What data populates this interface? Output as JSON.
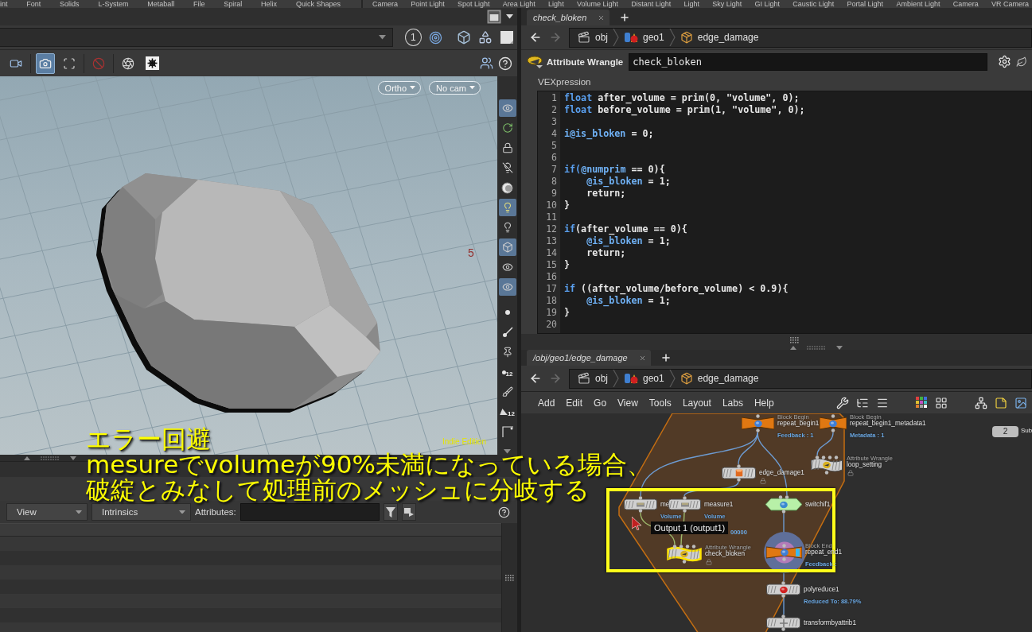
{
  "shelf": {
    "create_tools": [
      "int",
      "Font",
      "Solids",
      "L-System",
      "Metaball",
      "File",
      "Spiral",
      "Helix",
      "Quick Shapes"
    ],
    "light_tools": [
      "Camera",
      "Point Light",
      "Spot Light",
      "Area Light",
      "Light",
      "Volume Light",
      "Distant Light",
      "Light",
      "Sky Light",
      "GI Light",
      "Caustic Light",
      "Portal Light",
      "Ambient Light",
      "Camera",
      "VR Camera"
    ]
  },
  "viewer": {
    "layout_count": "1",
    "tools": [
      {
        "selected": false
      },
      {
        "selected": true
      },
      {
        "selected": false
      },
      {
        "selected": false
      },
      {
        "selected": false
      },
      {
        "selected": false
      }
    ],
    "camera_buttons": [
      {
        "label": "Ortho"
      },
      {
        "label": "No cam"
      }
    ],
    "grid_number": "5",
    "edition": "Indie Edition",
    "side_tools": [
      {
        "selected": true
      },
      {
        "selected": false
      },
      {
        "selected": false
      },
      {
        "selected": false
      },
      {
        "selected": false
      },
      {
        "selected": true
      },
      {
        "selected": false
      },
      {
        "selected": true
      },
      {
        "selected": false
      },
      {
        "selected": true
      },
      {
        "selected": false
      },
      {
        "selected": false
      },
      {
        "selected": false
      },
      {
        "selected": false,
        "label": "12"
      },
      {
        "selected": false
      },
      {
        "selected": false,
        "label": "12"
      },
      {
        "selected": false
      },
      {
        "selected": false
      }
    ]
  },
  "spreadsheet": {
    "view_menu": "View",
    "info_menu": "Intrinsics",
    "attributes_label": "Attributes:"
  },
  "parameters": {
    "tabs": [
      {
        "label": "check_bloken",
        "selected": true
      }
    ],
    "path": [
      {
        "label": "obj"
      },
      {
        "label": "geo1"
      },
      {
        "label": "edge_damage"
      }
    ],
    "node_type": "Attribute Wrangle",
    "node_name": "check_bloken",
    "code_label": "VEXpression",
    "code_lines": [
      {
        "number": "1",
        "tokens": [
          {
            "text": "float",
            "kind": "keyword"
          },
          {
            "text": " after_volume = prim(0, \"volume\", 0);",
            "kind": "plain"
          }
        ]
      },
      {
        "number": "2",
        "tokens": [
          {
            "text": "float",
            "kind": "keyword"
          },
          {
            "text": " before_volume = prim(1, \"volume\", 0);",
            "kind": "plain"
          }
        ]
      },
      {
        "number": "3"
      },
      {
        "number": "4",
        "tokens": [
          {
            "text": "i@is_bloken",
            "kind": "attr"
          },
          {
            "text": " = 0;",
            "kind": "plain"
          }
        ]
      },
      {
        "number": "5"
      },
      {
        "number": "6"
      },
      {
        "number": "7",
        "tokens": [
          {
            "text": "if(",
            "kind": "keyword"
          },
          {
            "text": "@numprim",
            "kind": "attr"
          },
          {
            "text": " == 0){",
            "kind": "plain"
          }
        ]
      },
      {
        "number": "8",
        "tokens": [
          {
            "text": "    @is_bloken",
            "kind": "attr"
          },
          {
            "text": " = 1;",
            "kind": "plain"
          }
        ]
      },
      {
        "number": "9",
        "tokens": [
          {
            "text": "    return;",
            "kind": "plain"
          }
        ]
      },
      {
        "number": "10",
        "tokens": [
          {
            "text": "}",
            "kind": "plain"
          }
        ]
      },
      {
        "number": "11"
      },
      {
        "number": "12",
        "tokens": [
          {
            "text": "if",
            "kind": "keyword"
          },
          {
            "text": "(after_volume == 0){",
            "kind": "plain"
          }
        ]
      },
      {
        "number": "13",
        "tokens": [
          {
            "text": "    @is_bloken",
            "kind": "attr"
          },
          {
            "text": " = 1;",
            "kind": "plain"
          }
        ]
      },
      {
        "number": "14",
        "tokens": [
          {
            "text": "    return;",
            "kind": "plain"
          }
        ]
      },
      {
        "number": "15",
        "tokens": [
          {
            "text": "}",
            "kind": "plain"
          }
        ]
      },
      {
        "number": "16"
      },
      {
        "number": "17",
        "tokens": [
          {
            "text": "if",
            "kind": "keyword"
          },
          {
            "text": " ((after_volume/before_volume) < 0.9){",
            "kind": "plain"
          }
        ]
      },
      {
        "number": "18",
        "tokens": [
          {
            "text": "    @is_bloken",
            "kind": "attr"
          },
          {
            "text": " = 1;",
            "kind": "plain"
          }
        ]
      },
      {
        "number": "19",
        "tokens": [
          {
            "text": "}",
            "kind": "plain"
          }
        ]
      },
      {
        "number": "20"
      }
    ]
  },
  "network": {
    "tabs": [
      {
        "label": "/obj/geo1/edge_damage",
        "selected": true
      }
    ],
    "path": [
      {
        "label": "obj"
      },
      {
        "label": "geo1"
      },
      {
        "label": "edge_damage"
      }
    ],
    "menu": [
      "Add",
      "Edit",
      "Go",
      "View",
      "Tools",
      "Layout",
      "Labs",
      "Help"
    ],
    "nodes": [
      {
        "kind": "block",
        "name": "repeat_begin1",
        "type": "Block Begin",
        "info": "Feedback : 1",
        "selected": false,
        "locked": false,
        "display": false
      },
      {
        "kind": "block",
        "name": "repeat_begin1_metadata1",
        "type": "Block Begin",
        "info": "Metadata : 1",
        "selected": false,
        "locked": false,
        "display": false
      },
      {
        "kind": "wrangle",
        "name": "loop_setting",
        "type": "Attribute Wrangle",
        "selected": false,
        "locked": true,
        "display": false
      },
      {
        "kind": "sop",
        "name": "edge_damage1",
        "selected": false,
        "locked": true,
        "display": false
      },
      {
        "kind": "sop",
        "name": "me",
        "info": "Volume",
        "selected": false,
        "locked": false,
        "display": false
      },
      {
        "kind": "sop",
        "name": "measure1",
        "info": "Volume",
        "selected": false,
        "locked": false,
        "display": false
      },
      {
        "kind": "switch",
        "name": "switchif1",
        "selected": false,
        "locked": false,
        "display": false
      },
      {
        "kind": "wrangle",
        "name": "check_bloken",
        "type": "Attribute Wrangle",
        "selected": true,
        "locked": true,
        "display": false
      },
      {
        "kind": "block",
        "name": "repeat_end1",
        "type": "Block End",
        "info": "Feedback :",
        "selected": false,
        "locked": false,
        "display": true
      },
      {
        "kind": "sop",
        "name": "polyreduce1",
        "info": "Reduced To: 88.79%",
        "selected": false,
        "locked": false,
        "display": false
      },
      {
        "kind": "sop",
        "name": "transformbyattrib1",
        "selected": false,
        "locked": false,
        "display": false
      }
    ],
    "tooltip": "Output 1 (output1)",
    "hidden_value": "00000",
    "subnet": {
      "count": "2",
      "label": "Sub"
    }
  },
  "annotation": {
    "title": "エラー回避",
    "lines": [
      "mesureでvolumeが90%未満になっている場合、",
      "破綻とみなして処理前のメッシュに分岐する"
    ]
  }
}
